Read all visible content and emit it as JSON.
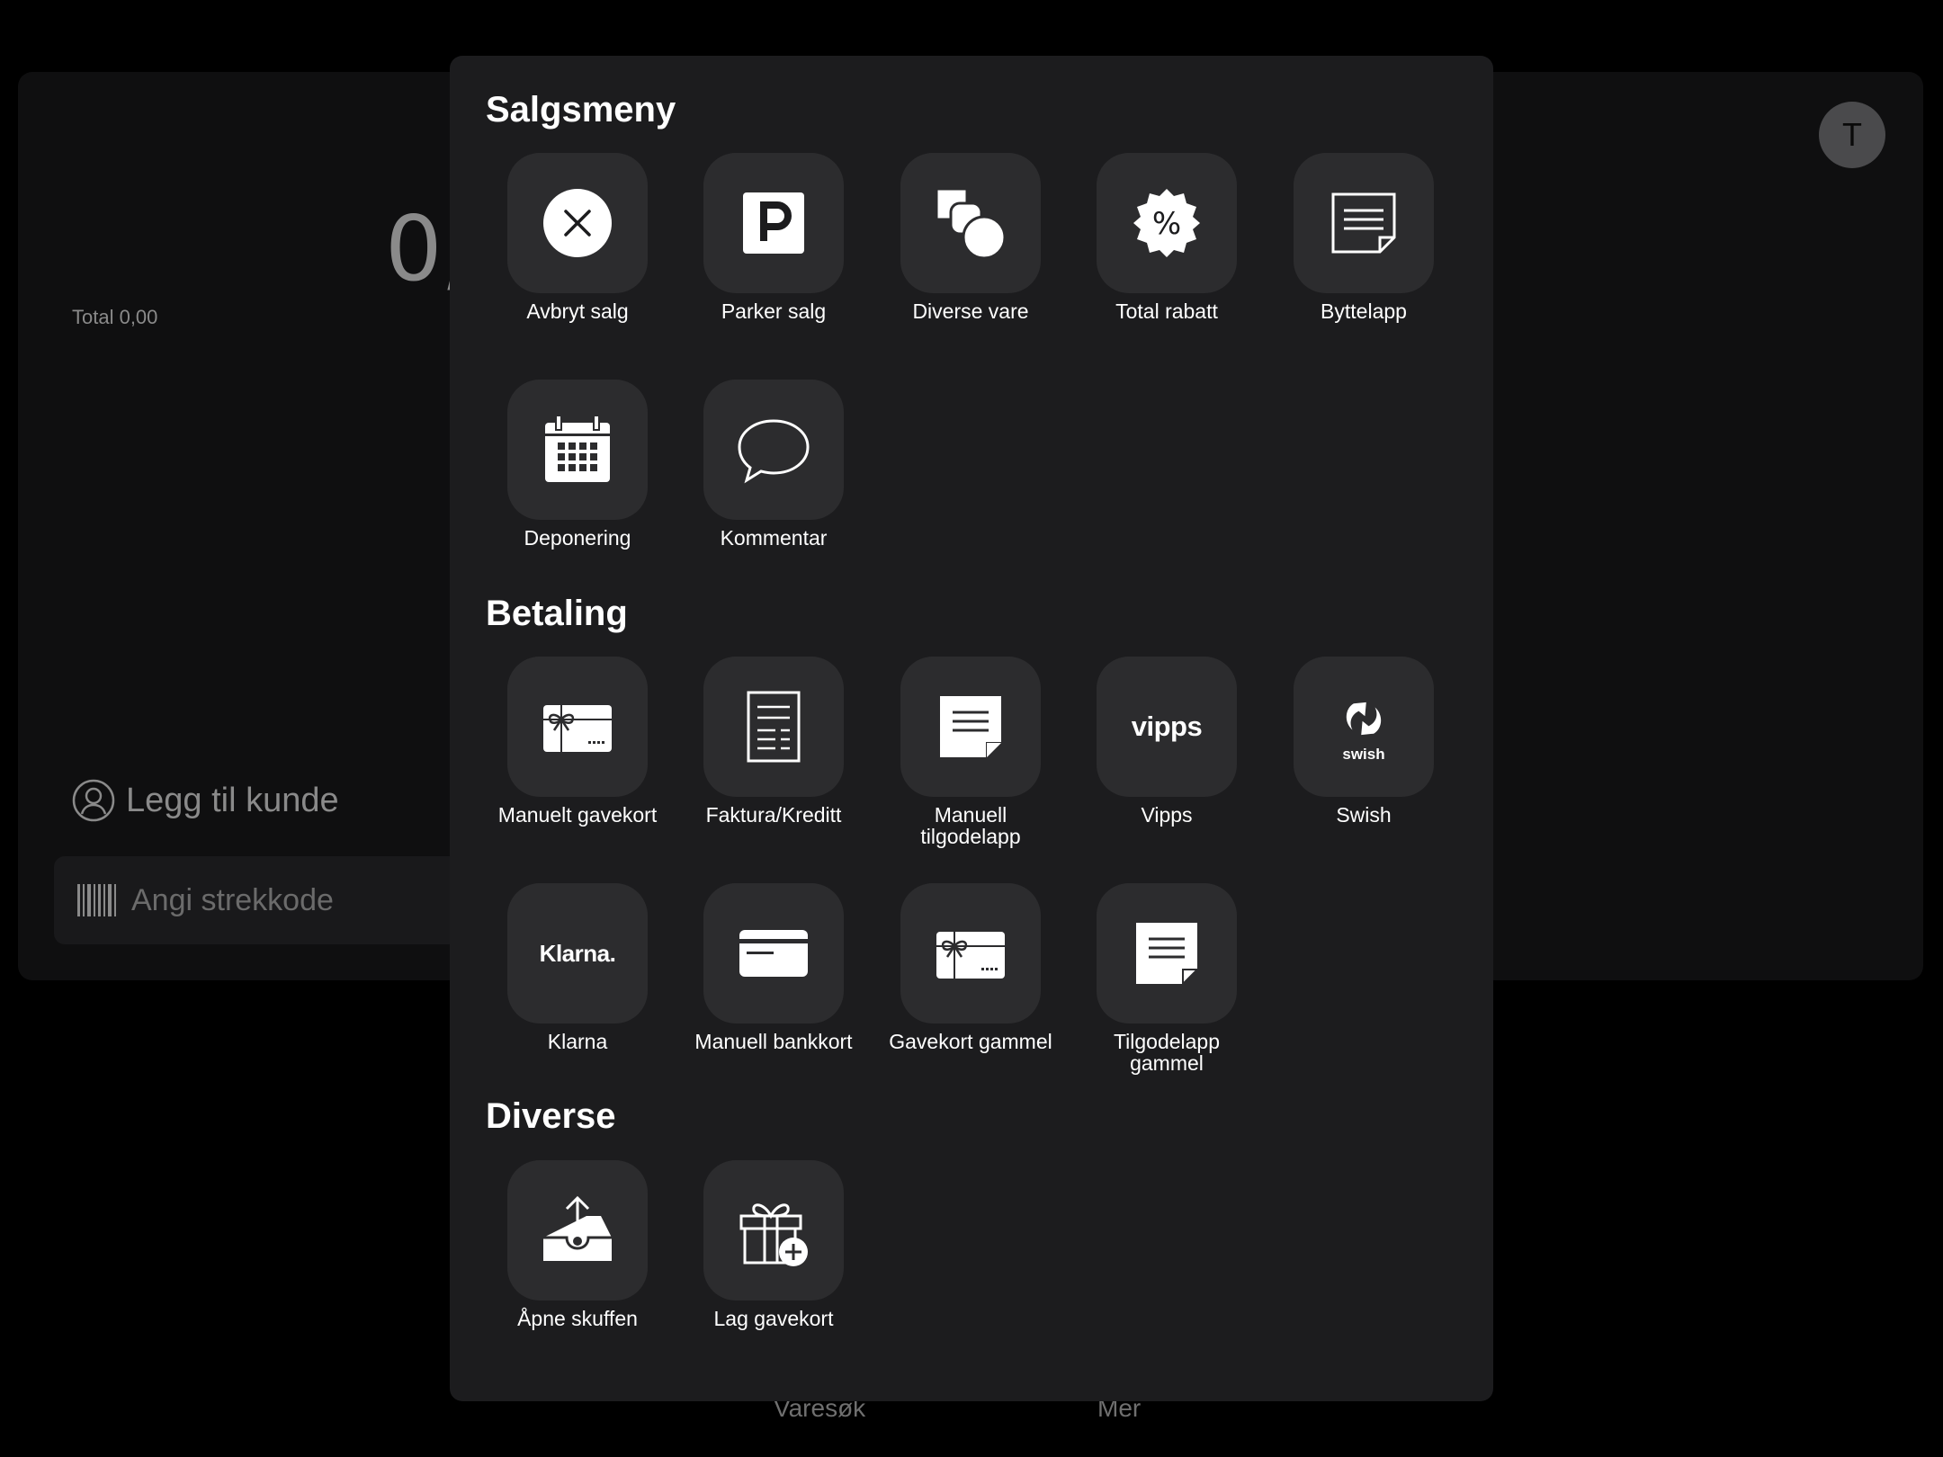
{
  "background": {
    "amount": "0,",
    "total": "Total 0,00",
    "avatar_initial": "T",
    "add_customer": "Legg til kunde",
    "barcode_placeholder": "Angi strekkode",
    "nav": [
      "Varesøk",
      "Mer"
    ]
  },
  "modal": {
    "sections": [
      {
        "title": "Salgsmeny",
        "items": [
          {
            "label": "Avbryt salg",
            "icon": "cancel-circle-icon"
          },
          {
            "label": "Parker salg",
            "icon": "parking-icon"
          },
          {
            "label": "Diverse vare",
            "icon": "shapes-icon"
          },
          {
            "label": "Total rabatt",
            "icon": "discount-badge-icon"
          },
          {
            "label": "Byttelapp",
            "icon": "note-icon"
          },
          {
            "label": "Deponering",
            "icon": "calendar-icon"
          },
          {
            "label": "Kommentar",
            "icon": "speech-bubble-icon"
          }
        ]
      },
      {
        "title": "Betaling",
        "items": [
          {
            "label": "Manuelt gavekort",
            "icon": "gift-card-icon"
          },
          {
            "label": "Faktura/Kreditt",
            "icon": "invoice-icon"
          },
          {
            "label": "Manuell\ntilgodelapp",
            "icon": "sticky-note-icon"
          },
          {
            "label": "Vipps",
            "icon": "vipps-logo",
            "logo_text": "vipps"
          },
          {
            "label": "Swish",
            "icon": "swish-logo",
            "logo_text": "swish"
          },
          {
            "label": "Klarna",
            "icon": "klarna-logo",
            "logo_text": "Klarna."
          },
          {
            "label": "Manuell bankkort",
            "icon": "bank-card-icon"
          },
          {
            "label": "Gavekort gammel",
            "icon": "gift-card-icon"
          },
          {
            "label": "Tilgodelapp\ngammel",
            "icon": "sticky-note-icon"
          }
        ]
      },
      {
        "title": "Diverse",
        "items": [
          {
            "label": "Åpne skuffen",
            "icon": "open-drawer-icon"
          },
          {
            "label": "Lag gavekort",
            "icon": "gift-add-icon"
          }
        ]
      }
    ]
  }
}
